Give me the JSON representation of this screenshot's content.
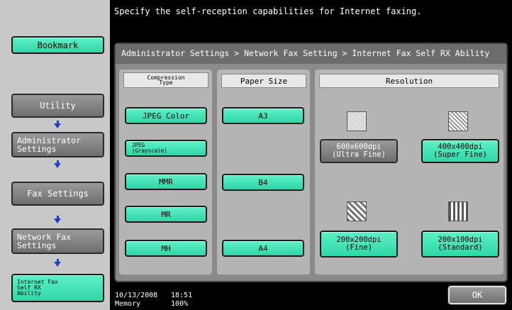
{
  "instruction": "Specify the self-reception capabilities for Internet faxing.",
  "breadcrumb": "Administrator Settings > Network Fax Setting > Internet Fax Self RX Ability",
  "sidebar": {
    "bookmark": "Bookmark",
    "utility": "Utility",
    "admin_line1": "Administrator",
    "admin_line2": "Settings",
    "fax_settings": "Fax Settings",
    "network_line1": "Network Fax",
    "network_line2": "Settings",
    "ifax_line1": "Internet Fax",
    "ifax_line2": "Self RX",
    "ifax_line3": "Ability"
  },
  "compression": {
    "header_line1": "Compression",
    "header_line2": "Type",
    "jpeg_color": "JPEG Color",
    "jpeg_gray_line1": "JPEG",
    "jpeg_gray_line2": "(Grayscale)",
    "mmr": "MMR",
    "mr": "MR",
    "mh": "MH"
  },
  "paper": {
    "header": "Paper Size",
    "a3": "A3",
    "b4": "B4",
    "a4": "A4"
  },
  "resolution": {
    "header": "Resolution",
    "ultra_line1": "600x600dpi",
    "ultra_line2": "(Ultra Fine)",
    "super_line1": "400x400dpi",
    "super_line2": "(Super Fine)",
    "fine_line1": "200x200dpi",
    "fine_line2": "(Fine)",
    "std_line1": "200x100dpi",
    "std_line2": "(Standard)"
  },
  "status": {
    "date": "10/13/2008",
    "time": "18:51",
    "memory_label": "Memory",
    "memory_value": "100%"
  },
  "ok_label": "OK",
  "colors": {
    "selected_button": "#2fd6a6",
    "unselected_button": "#6e6e6e",
    "arrow": "#1e3ec8"
  }
}
